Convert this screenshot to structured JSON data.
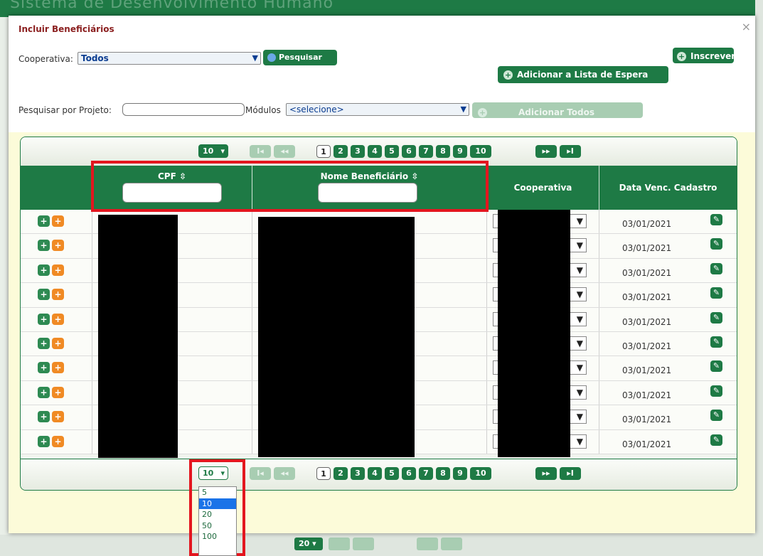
{
  "background": {
    "title": "Sistema de Desenvolvimento Humano",
    "pager_size": "20"
  },
  "modal": {
    "title": "Incluir Beneficiários",
    "close_icon": "×"
  },
  "form": {
    "cooperativa_label": "Cooperativa:",
    "cooperativa_value": "Todos",
    "pesquisar_label": "Pesquisar",
    "inscrever_label": "Inscrever",
    "adicionar_lista_label": "Adicionar a Lista de Espera",
    "pesquisar_projeto_label": "Pesquisar por Projeto:",
    "modulos_label": "Módulos",
    "modulos_value": "<selecione>",
    "adicionar_todos_label": "Adicionar Todos"
  },
  "pager": {
    "page_size": "10",
    "pages": [
      "1",
      "2",
      "3",
      "4",
      "5",
      "6",
      "7",
      "8",
      "9",
      "10"
    ],
    "current_page": "1",
    "first_icon": "I◂",
    "prev_icon": "◂◂",
    "next_icon": "▸▸",
    "last_icon": "▸I"
  },
  "table": {
    "columns": [
      "CPF ⇳",
      "Nome Beneficiário ⇳",
      "Cooperativa",
      "Data Venc. Cadastro"
    ],
    "rows": [
      {
        "date": "03/01/2021"
      },
      {
        "date": "03/01/2021"
      },
      {
        "date": "03/01/2021"
      },
      {
        "date": "03/01/2021"
      },
      {
        "date": "03/01/2021"
      },
      {
        "date": "03/01/2021"
      },
      {
        "date": "03/01/2021"
      },
      {
        "date": "03/01/2021"
      },
      {
        "date": "03/01/2021"
      },
      {
        "date": "03/01/2021"
      }
    ]
  },
  "page_size_dropdown": {
    "options": [
      "5",
      "10",
      "20",
      "50",
      "100"
    ],
    "selected": "10"
  },
  "colors": {
    "primary_green": "#1e7a45",
    "modal_bg": "#fcfbd9",
    "title_red": "#8b1f1f",
    "highlight_red": "#e3161f",
    "orange": "#f08a24",
    "selected_blue": "#1a73e8"
  }
}
